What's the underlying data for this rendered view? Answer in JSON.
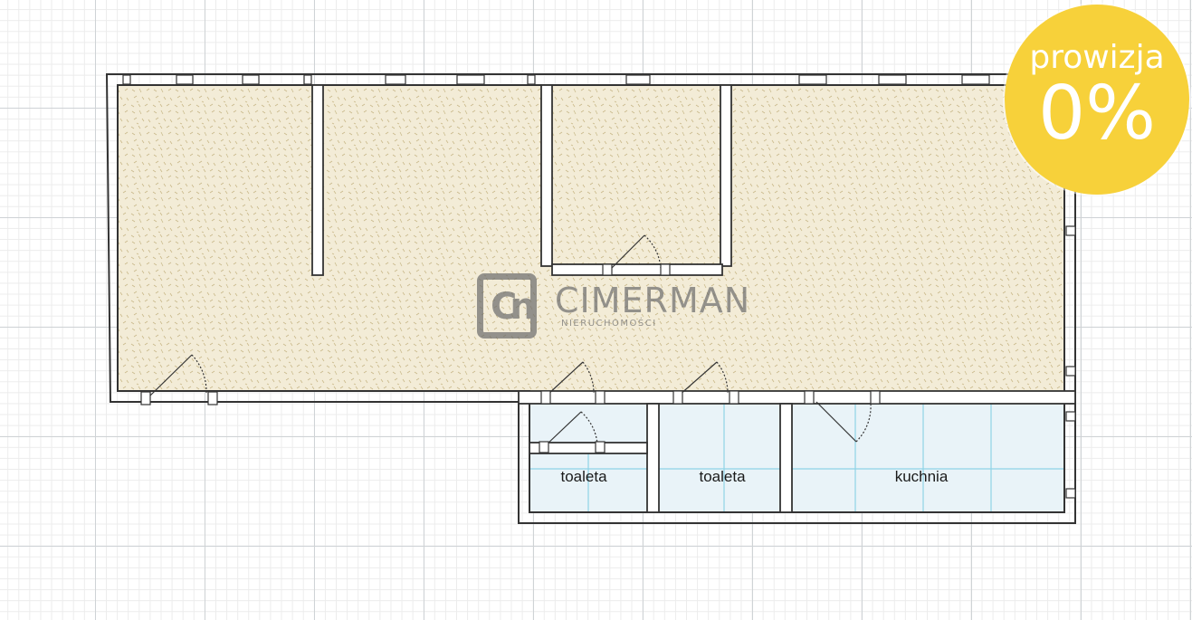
{
  "rooms": {
    "toilet_1": "toaleta",
    "toilet_2": "toaleta",
    "kitchen": "kuchnia"
  },
  "watermark": {
    "name": "CIMERMAN",
    "subtitle": "NIERUCHOMOŚCI"
  },
  "badge": {
    "line1": "prowizja",
    "line2": "0%"
  },
  "colors": {
    "floor_main": "#f3ecd7",
    "floor_tile": "#e9f3f8",
    "tile_lines": "#8fd3e6",
    "wall": "#333333",
    "badge": "#f7d13a"
  }
}
